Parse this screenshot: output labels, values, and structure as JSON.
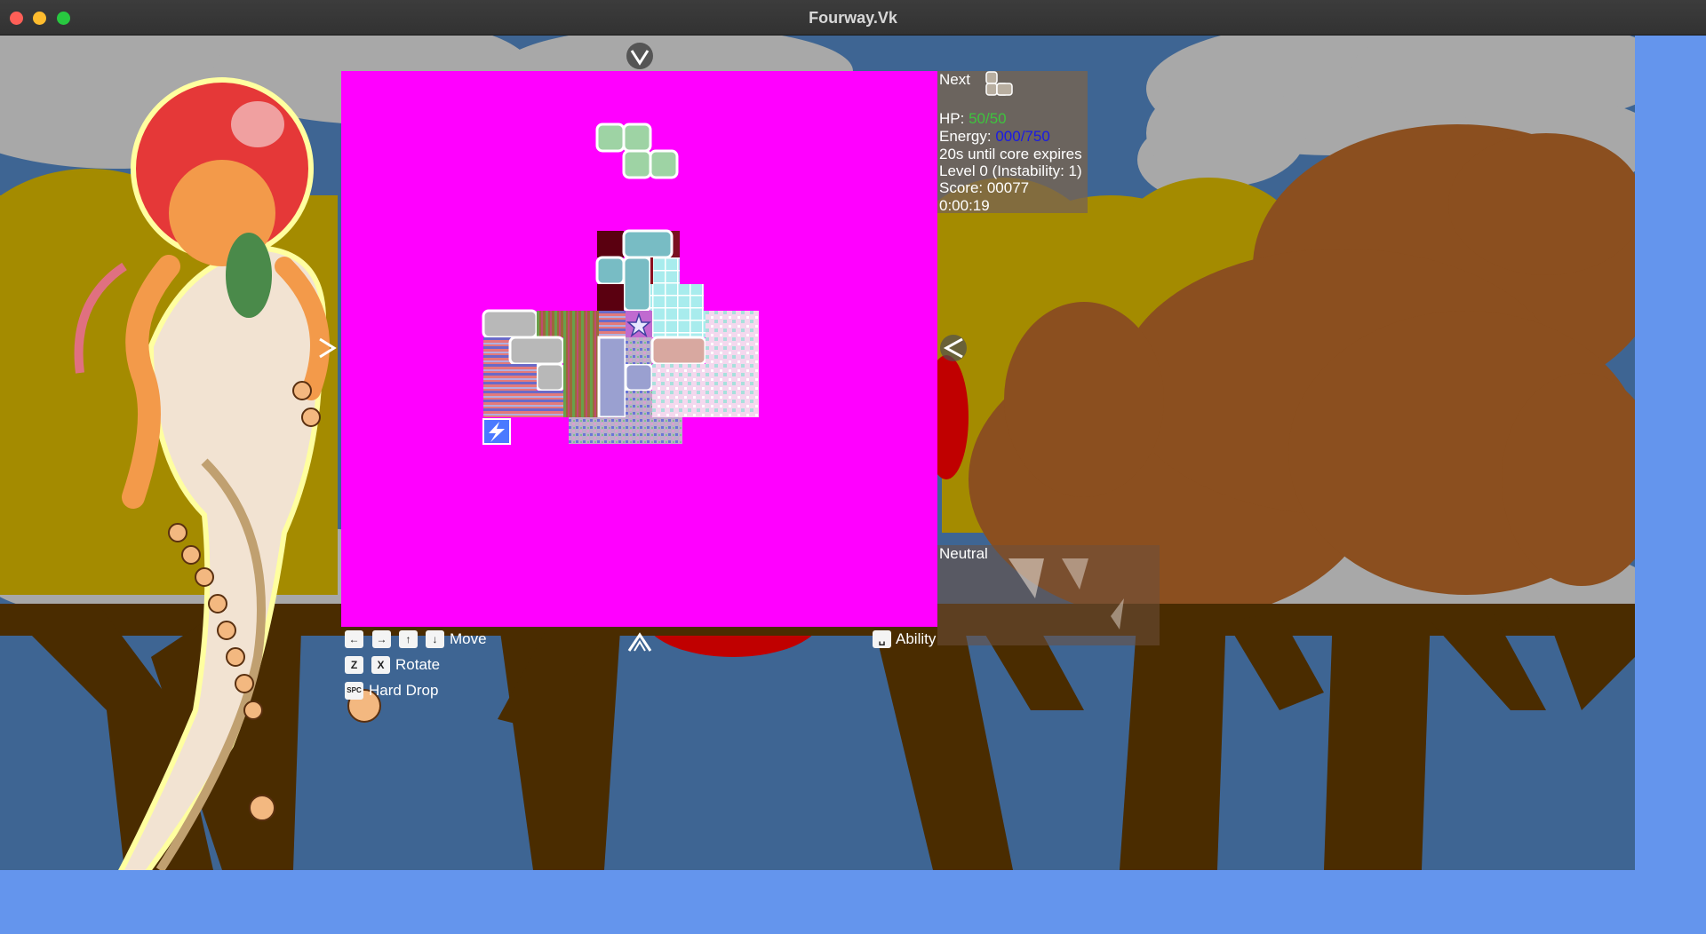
{
  "window": {
    "title": "Fourway.Vk"
  },
  "colors": {
    "board": "#ff00ff",
    "background": "#6495ed",
    "hp_value": "#3ec43e",
    "energy_value": "#1a1ae6"
  },
  "hud": {
    "next_label": "Next",
    "hp_label": "HP:",
    "hp_value": "50/50",
    "energy_label": "Energy:",
    "energy_value": "000/750",
    "core_timer": "20s until core expires",
    "level": "Level 0 (Instability: 1)",
    "score": "Score: 00077",
    "elapsed": "0:00:19"
  },
  "status_panel": {
    "label": "Neutral"
  },
  "controls": {
    "move_keys": [
      "←",
      "→",
      "↑",
      "↓"
    ],
    "move_label": "Move",
    "rotate_keys": [
      "Z",
      "X"
    ],
    "rotate_label": "Rotate",
    "hard_drop_key": "SPC",
    "hard_drop_label": "Hard Drop",
    "ability_key": "␣",
    "ability_label": "Ability"
  },
  "icons": {
    "top_arrow": "chevron-down-icon",
    "bottom_arrow": "chevron-up-icon",
    "right_arrow": "chevron-left-icon",
    "left_arrow": "chevron-right-icon",
    "next_piece": "tetromino-preview-icon",
    "bomb": "lightning-bomb-icon"
  }
}
